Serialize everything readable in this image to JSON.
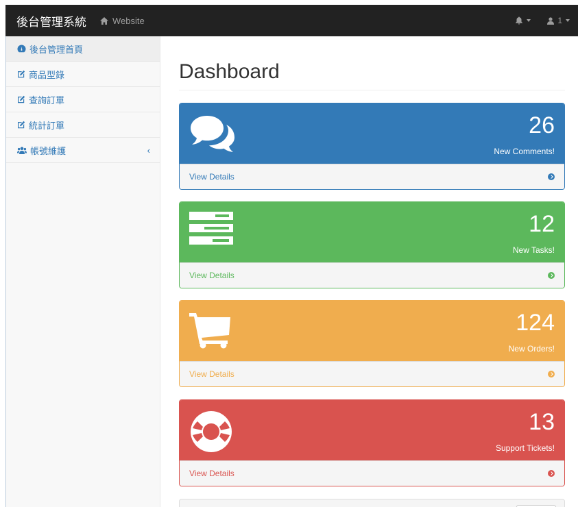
{
  "navbar": {
    "brand": "後台管理系統",
    "website_link": "Website",
    "user_label": "1"
  },
  "sidebar": {
    "items": [
      {
        "label": "後台管理首頁",
        "icon": "dashboard-icon"
      },
      {
        "label": "商品型錄",
        "icon": "edit-icon"
      },
      {
        "label": "查詢訂單",
        "icon": "edit-icon"
      },
      {
        "label": "統計訂單",
        "icon": "edit-icon"
      },
      {
        "label": "帳號維護",
        "icon": "users-icon"
      }
    ],
    "expand_glyph": "‹"
  },
  "main": {
    "title": "Dashboard",
    "panels": [
      {
        "count": "26",
        "label": "New Comments!",
        "footer": "View Details",
        "icon": "comments-icon",
        "color": "#337ab7"
      },
      {
        "count": "12",
        "label": "New Tasks!",
        "footer": "View Details",
        "icon": "tasks-icon",
        "color": "#5cb85c"
      },
      {
        "count": "124",
        "label": "New Orders!",
        "footer": "View Details",
        "icon": "shopping-cart-icon",
        "color": "#f0ad4e"
      },
      {
        "count": "13",
        "label": "Support Tickets!",
        "footer": "View Details",
        "icon": "life-ring-icon",
        "color": "#d9534f"
      }
    ]
  }
}
